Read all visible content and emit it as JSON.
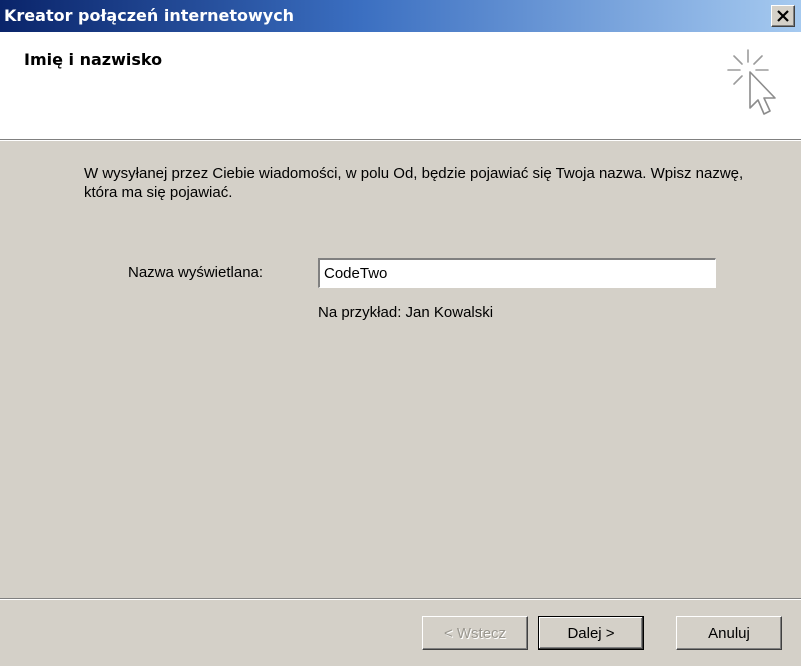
{
  "window": {
    "title": "Kreator połączeń internetowych",
    "close_glyph": "✕"
  },
  "header": {
    "title": "Imię i nazwisko",
    "icon": "wizard-cursor-icon"
  },
  "body": {
    "description": "W wysyłanej przez Ciebie wiadomości, w polu Od, będzie pojawiać się Twoja nazwa. Wpisz nazwę, która ma się pojawiać.",
    "display_name_label": "Nazwa wyświetlana:",
    "display_name_value": "CodeTwo",
    "example_hint": "Na przykład: Jan Kowalski"
  },
  "buttons": {
    "back": "< Wstecz",
    "next": "Dalej >",
    "cancel": "Anuluj"
  },
  "colors": {
    "titlebar_start": "#0a246a",
    "titlebar_end": "#a6caf0",
    "dialog_bg": "#d4d0c8",
    "header_bg": "#ffffff"
  }
}
